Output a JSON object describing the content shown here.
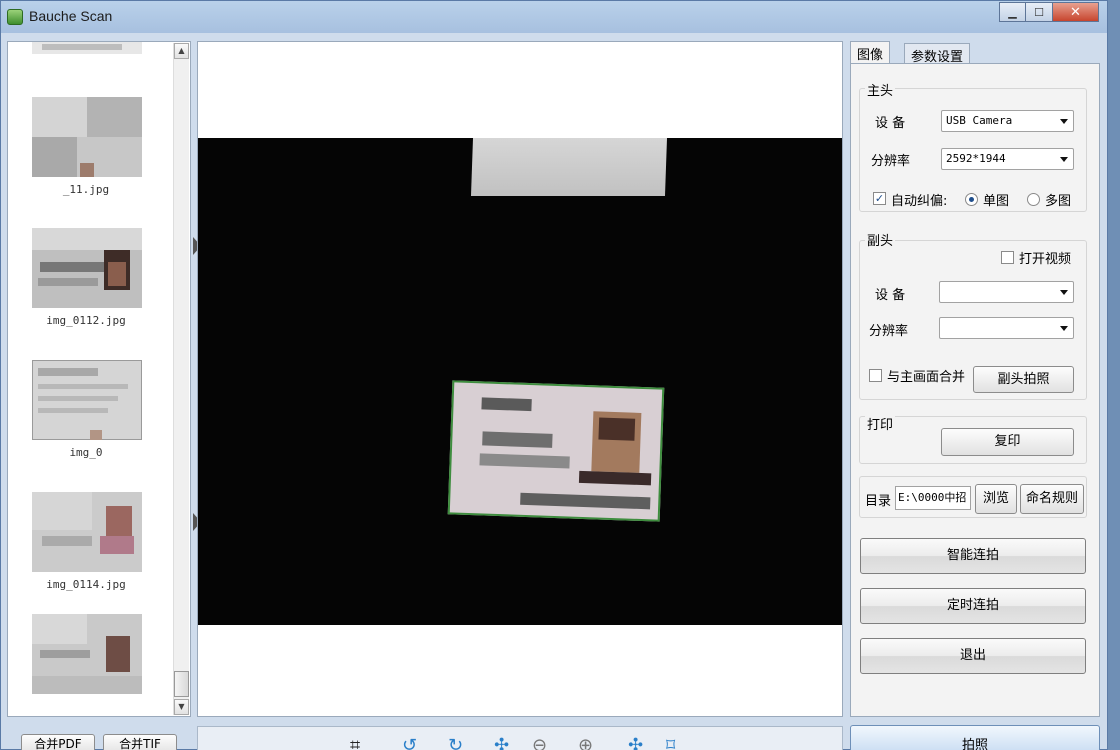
{
  "window": {
    "title": "Bauche Scan",
    "controls": {
      "minimize": "▁",
      "maximize": "☐",
      "close": "✕"
    }
  },
  "thumbnails": [
    {
      "caption": ""
    },
    {
      "caption": "    _11.jpg"
    },
    {
      "caption": "img_0112.jpg"
    },
    {
      "caption": "img_0"
    },
    {
      "caption": "img_0114.jpg"
    },
    {
      "caption": ""
    }
  ],
  "bottom": {
    "merge_pdf": "合并PDF",
    "merge_tif": "合并TIF",
    "tools": [
      "crop-icon",
      "rotate-left-icon",
      "rotate-right-icon",
      "fit-icon",
      "zoom-out-icon",
      "zoom-in-icon",
      "actual-size-icon",
      "fullscreen-icon"
    ]
  },
  "tabs": {
    "image": "图像",
    "params": "参数设置"
  },
  "main_head": {
    "label": "主头",
    "device_label": "设 备",
    "device_value": "USB Camera",
    "resolution_label": "分辨率",
    "resolution_value": "2592*1944",
    "auto_deskew_label": "自动纠偏:",
    "auto_deskew_checked": true,
    "single_label": "单图",
    "multi_label": "多图",
    "mode": "single"
  },
  "sub_head": {
    "label": "副头",
    "open_video_label": "打开视频",
    "open_video_checked": false,
    "device_label": "设 备",
    "device_value": "",
    "resolution_label": "分辨率",
    "resolution_value": "",
    "merge_label": "与主画面合并",
    "merge_checked": false,
    "capture_button": "副头拍照"
  },
  "print": {
    "label": "打印",
    "copy_button": "复印"
  },
  "directory": {
    "label": "目录",
    "value": "E:\\0000中招",
    "browse_button": "浏览",
    "naming_button": "命名规则"
  },
  "actions": {
    "smart_continuous": "智能连拍",
    "timed_continuous": "定时连拍",
    "exit": "退出"
  },
  "capture_button": "拍照"
}
